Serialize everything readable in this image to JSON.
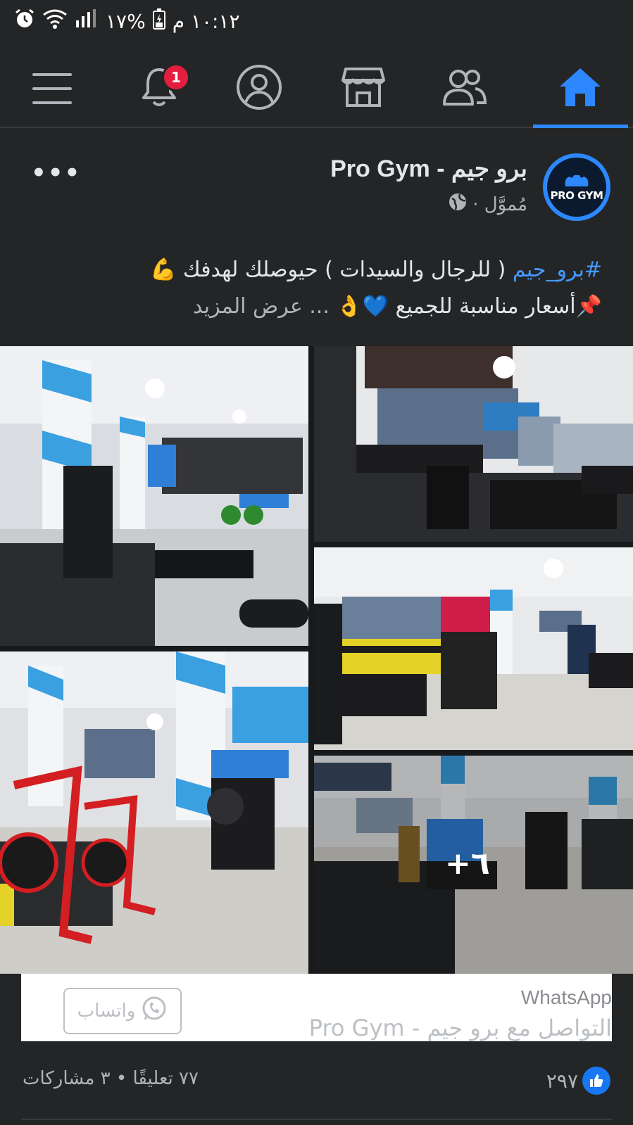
{
  "status_bar": {
    "time": "١٠:١٢ م",
    "battery": "%١٧"
  },
  "navbar": {
    "items": [
      {
        "name": "menu"
      },
      {
        "name": "notifications",
        "badge": "1"
      },
      {
        "name": "profile"
      },
      {
        "name": "marketplace"
      },
      {
        "name": "groups"
      },
      {
        "name": "home",
        "active": true
      }
    ],
    "accent": "#2d88ff"
  },
  "post": {
    "page_name": "برو جيم - Pro Gym",
    "avatar_text": "PRO GYM",
    "sponsored": "مُموَّل ·",
    "more": "•••",
    "text_line1_hashtag": "#برو_جيم",
    "text_line1_rest": " ( للرجال والسيدات ) حيوصلك لهدفك 💪",
    "text_line2": "📌أسعار مناسبة للجميع 💙👌",
    "see_more": "... عرض المزيد",
    "more_photos": "+٦"
  },
  "whatsapp_card": {
    "title": "WhatsApp",
    "subtitle": "التواصل مع برو جيم - Pro Gym",
    "button_label": "واتساب"
  },
  "stats": {
    "likes": "٢٩٧",
    "comments_shares": "٧٧ تعليقًا • ٣ مشاركات"
  }
}
